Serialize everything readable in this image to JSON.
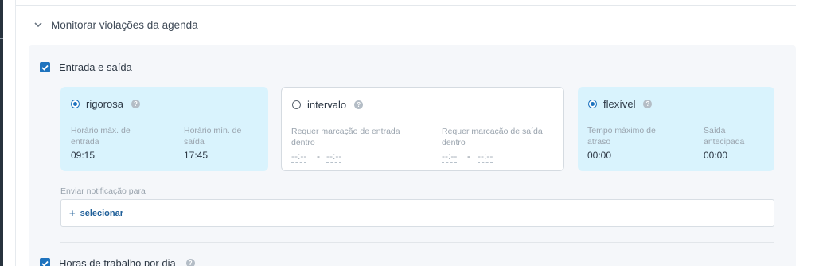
{
  "section": {
    "title": "Monitorar violações da agenda"
  },
  "entry_exit": {
    "label": "Entrada e saída",
    "checked": true
  },
  "modes": [
    {
      "title": "rigorosa",
      "selected": true,
      "fields": [
        {
          "label": "Horário máx. de entrada",
          "value": "09:15"
        },
        {
          "label": "Horário mín. de saída",
          "value": "17:45"
        }
      ]
    },
    {
      "title": "intervalo",
      "selected": false,
      "fields": [
        {
          "label": "Requer marcação de entrada dentro",
          "from": "--:--",
          "to": "--:--"
        },
        {
          "label": "Requer marcação de saída dentro",
          "from": "--:--",
          "to": "--:--"
        }
      ]
    },
    {
      "title": "flexível",
      "selected": true,
      "fields": [
        {
          "label": "Tempo máximo de atraso",
          "value": "00:00"
        },
        {
          "label": "Saída antecipada",
          "value": "00:00"
        }
      ]
    }
  ],
  "range_separator": "-",
  "notify": {
    "label": "Enviar notificação para",
    "button_label": "selecionar"
  },
  "work_hours": {
    "label": "Horas de trabalho por dia",
    "checked": true
  },
  "colors": {
    "accent": "#1e73be",
    "active_card": "#d9f3fd",
    "panel_bg": "#f5f7fa"
  },
  "icons": [
    "chevron-down-icon",
    "check-icon",
    "radio-icon",
    "help-icon",
    "plus-icon"
  ]
}
